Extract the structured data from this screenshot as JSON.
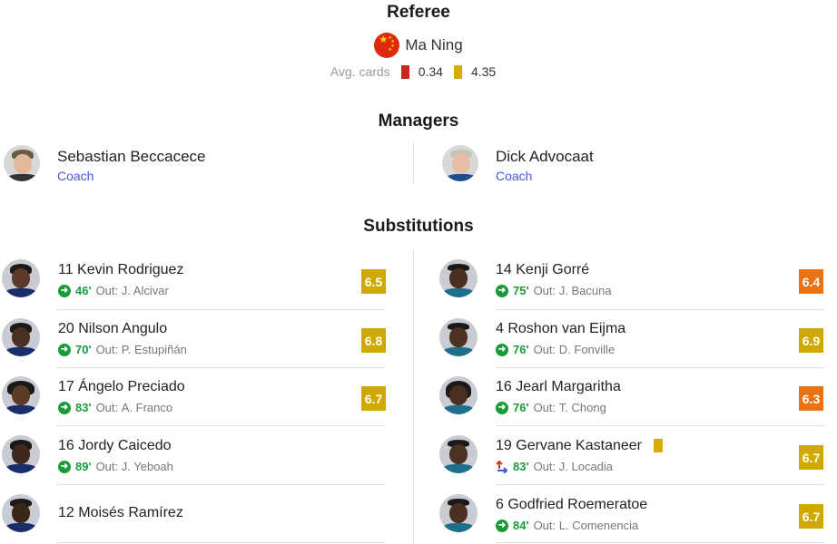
{
  "referee": {
    "title": "Referee",
    "flag": "china-flag",
    "name": "Ma Ning",
    "avg_label": "Avg. cards",
    "red_avg": "0.34",
    "yellow_avg": "4.35"
  },
  "managers": {
    "title": "Managers",
    "home": {
      "name": "Sebastian Beccacece",
      "role": "Coach"
    },
    "away": {
      "name": "Dick Advocaat",
      "role": "Coach"
    }
  },
  "substitutions": {
    "title": "Substitutions",
    "out_label": "Out:",
    "home": [
      {
        "player": "11 Kevin Rodriguez",
        "minute": "46'",
        "out": "J. Alcivar",
        "rating": "6.5",
        "rating_color": "#cfa800"
      },
      {
        "player": "20 Nilson Angulo",
        "minute": "70'",
        "out": "P. Estupiñán",
        "rating": "6.8",
        "rating_color": "#cfa800"
      },
      {
        "player": "17 Ángelo Preciado",
        "minute": "83'",
        "out": "A. Franco",
        "rating": "6.7",
        "rating_color": "#cfa800"
      },
      {
        "player": "16 Jordy Caicedo",
        "minute": "89'",
        "out": "J. Yeboah",
        "rating": "",
        "rating_color": ""
      },
      {
        "player": "12 Moisés Ramírez",
        "minute": "",
        "out": "",
        "rating": "",
        "rating_color": ""
      }
    ],
    "away": [
      {
        "player": "14 Kenji Gorré",
        "minute": "75'",
        "out": "J. Bacuna",
        "rating": "6.4",
        "rating_color": "#e97312"
      },
      {
        "player": "4 Roshon van Eijma",
        "minute": "76'",
        "out": "D. Fonville",
        "rating": "6.9",
        "rating_color": "#cfa800"
      },
      {
        "player": "16 Jearl Margaritha",
        "minute": "76'",
        "out": "T. Chong",
        "rating": "6.3",
        "rating_color": "#e97312"
      },
      {
        "player": "19 Gervane Kastaneer",
        "minute": "83'",
        "out": "J. Locadia",
        "rating": "6.7",
        "rating_color": "#cfa800",
        "yellow_card": true,
        "icon": "swap-arrows-icon"
      },
      {
        "player": "6 Godfried Roemeratoe",
        "minute": "84'",
        "out": "L. Comenencia",
        "rating": "6.7",
        "rating_color": "#cfa800"
      }
    ]
  }
}
